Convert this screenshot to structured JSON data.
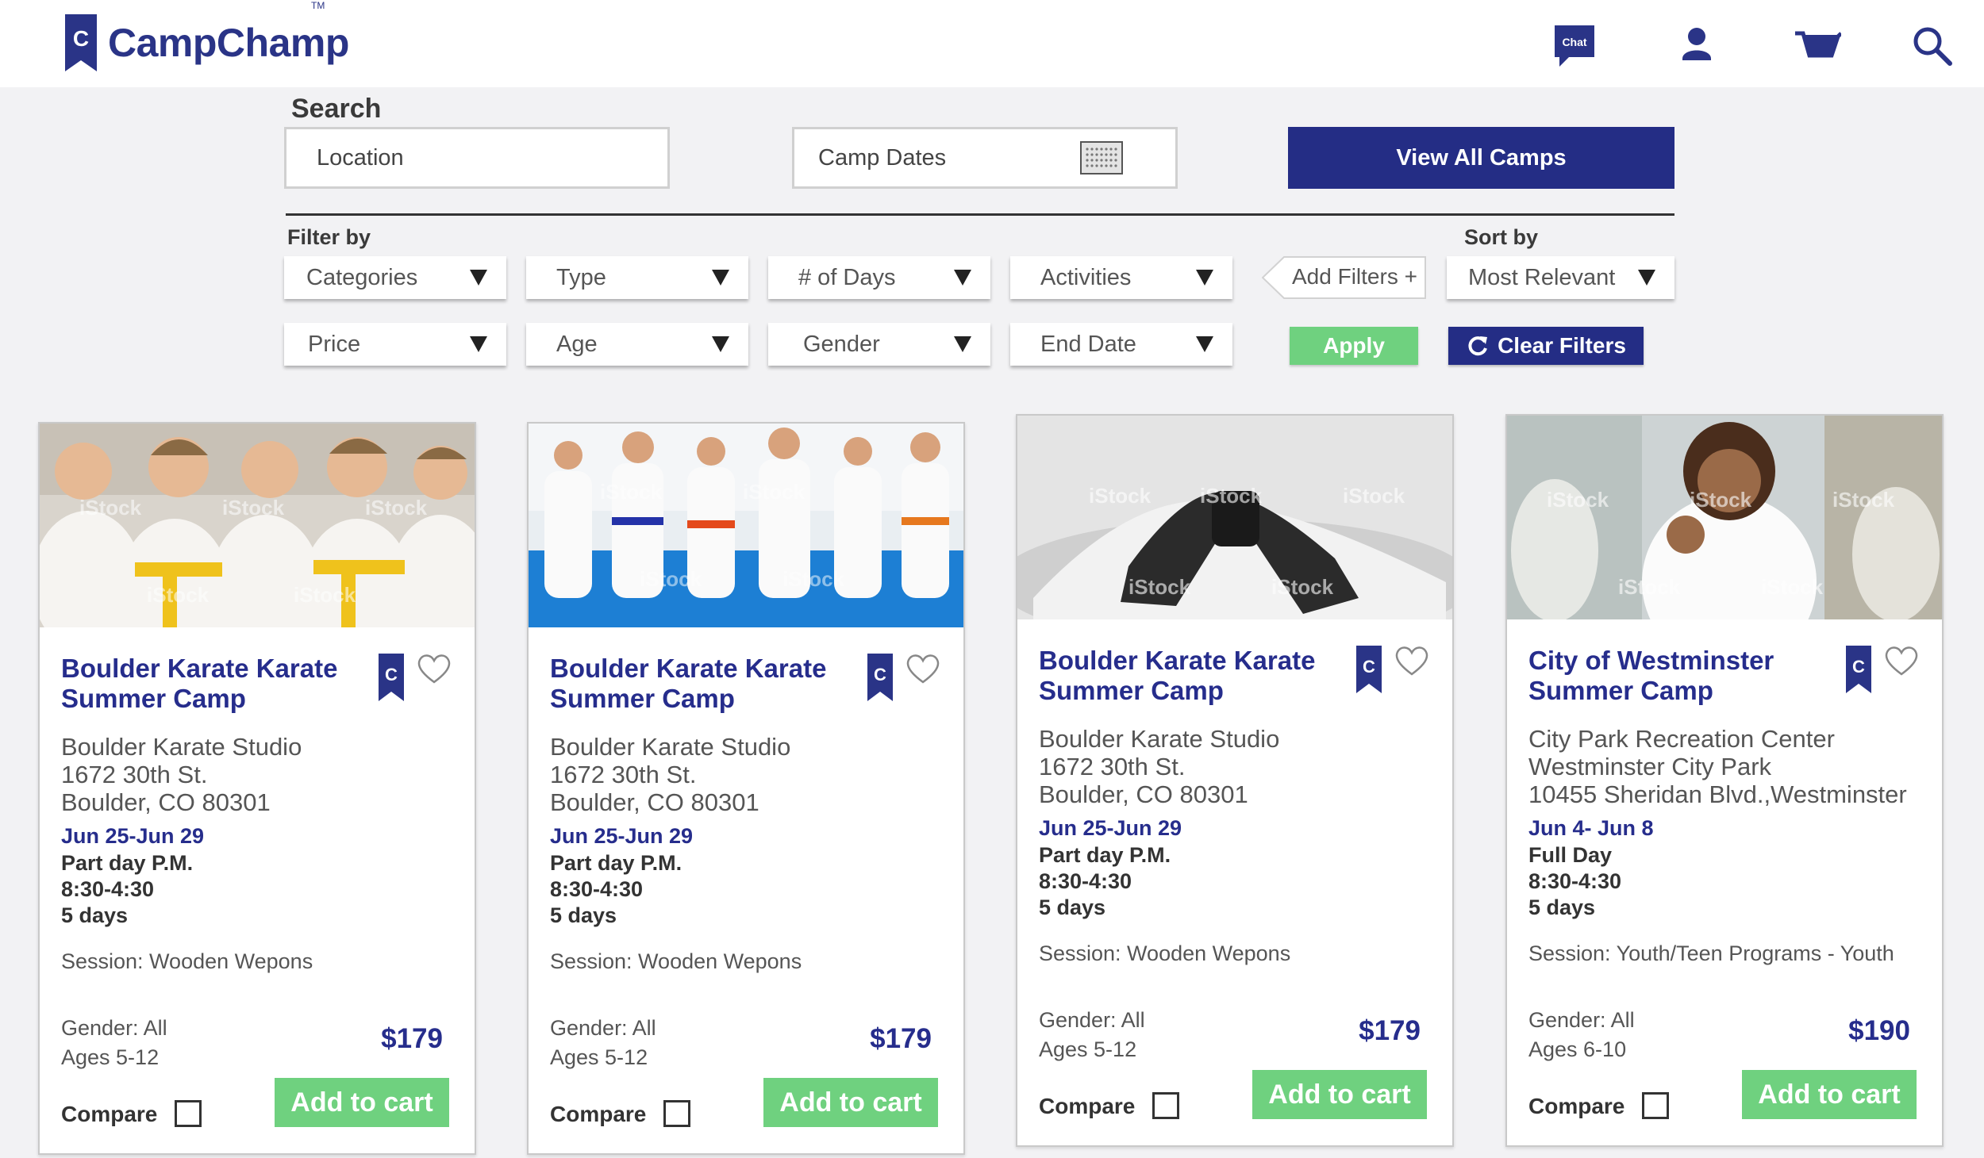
{
  "brand": {
    "name": "CampChamp",
    "tm": "TM",
    "badge_letter": "C",
    "color": "#2a3487"
  },
  "header_icons": {
    "chat_label": "Chat"
  },
  "search": {
    "label": "Search",
    "location_placeholder": "Location",
    "dates_placeholder": "Camp Dates",
    "view_all": "View All Camps"
  },
  "filters": {
    "label": "Filter by",
    "row1": [
      "Categories",
      "Type",
      "# of Days",
      "Activities"
    ],
    "row2": [
      "Price",
      "Age",
      "Gender",
      "End Date"
    ],
    "add_filters": "Add Filters +",
    "apply": "Apply",
    "clear": "Clear Filters"
  },
  "sort": {
    "label": "Sort by",
    "value": "Most Relevant"
  },
  "colors": {
    "navy": "#242d85",
    "green": "#6fd17f",
    "title_blue": "#262d8c"
  },
  "cards": [
    {
      "title": "Boulder Karate Karate Summer Camp",
      "address": "Boulder Karate Studio\n1672 30th St.\nBoulder, CO 80301",
      "dates": "Jun 25-Jun 29",
      "day_type": "Part day P.M.",
      "hours": "8:30-4:30",
      "days": "5 days",
      "session": "Session: Wooden Wepons",
      "gender": "Gender: All",
      "ages": "Ages 5-12",
      "price": "$179",
      "add_to_cart": "Add to cart",
      "compare": "Compare",
      "watermark": "iStock"
    },
    {
      "title": "Boulder Karate Karate Summer Camp",
      "address": "Boulder Karate Studio\n1672 30th St.\nBoulder, CO 80301",
      "dates": "Jun 25-Jun 29",
      "day_type": "Part day P.M.",
      "hours": "8:30-4:30",
      "days": "5 days",
      "session": "Session: Wooden Wepons",
      "gender": "Gender: All",
      "ages": "Ages 5-12",
      "price": "$179",
      "add_to_cart": "Add to cart",
      "compare": "Compare",
      "watermark": "iStock"
    },
    {
      "title": "Boulder Karate Karate Summer Camp",
      "address": "Boulder Karate Studio\n1672 30th St.\nBoulder, CO 80301",
      "dates": "Jun 25-Jun 29",
      "day_type": "Part day P.M.",
      "hours": "8:30-4:30",
      "days": "5 days",
      "session": "Session: Wooden Wepons",
      "gender": "Gender: All",
      "ages": "Ages 5-12",
      "price": "$179",
      "add_to_cart": "Add to cart",
      "compare": "Compare",
      "watermark": "iStock"
    },
    {
      "title": "City of Westminster Summer Camp",
      "address": "City Park Recreation Center\nWestminster City Park\n10455 Sheridan Blvd.,Westminster",
      "dates": "Jun 4- Jun 8",
      "day_type": "Full Day",
      "hours": "8:30-4:30",
      "days": "5 days",
      "session": "Session: Youth/Teen Programs - Youth",
      "gender": "Gender: All",
      "ages": "Ages 6-10",
      "price": "$190",
      "add_to_cart": "Add to cart",
      "compare": "Compare",
      "watermark": "iStock"
    }
  ]
}
